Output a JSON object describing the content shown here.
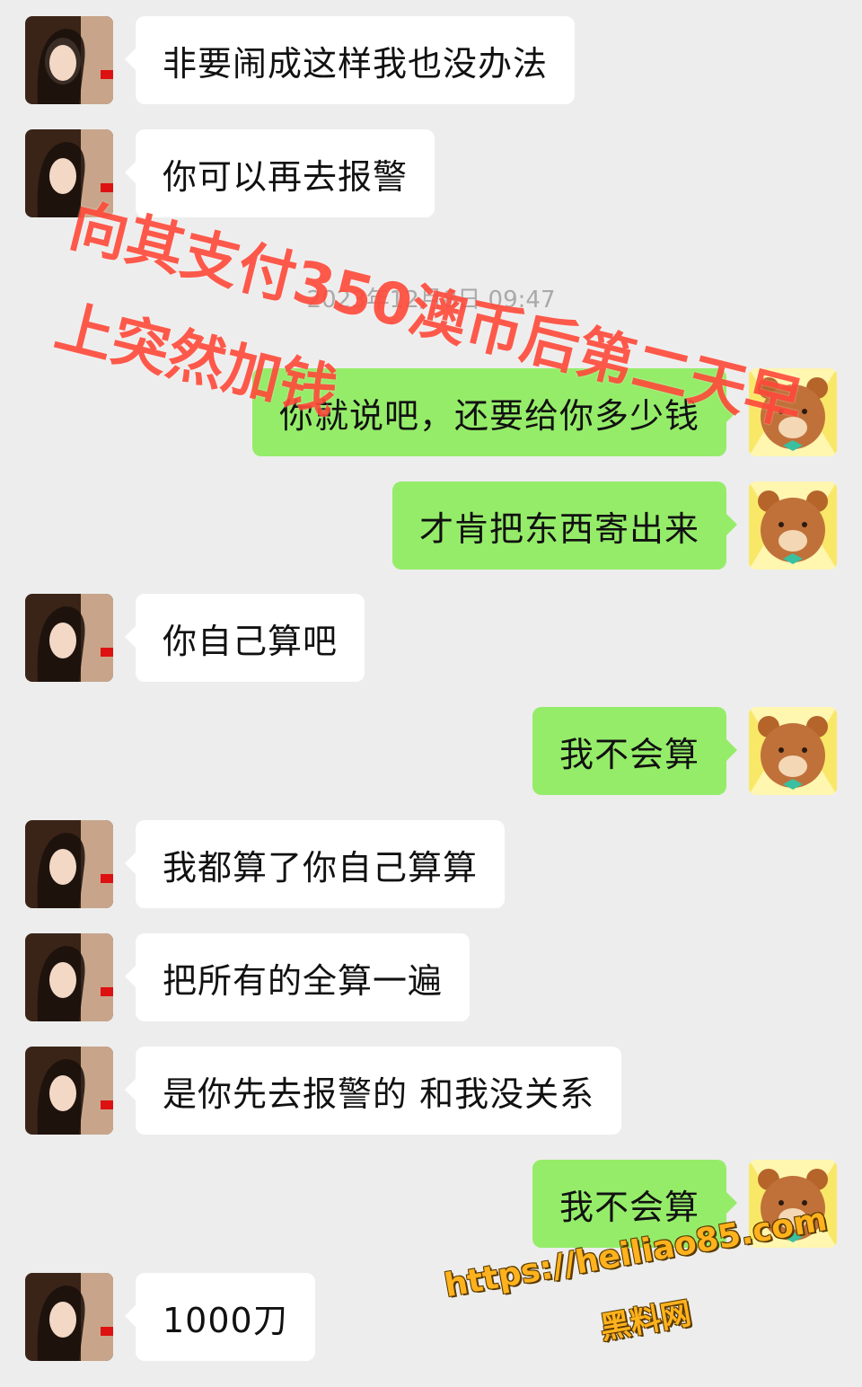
{
  "messages": [
    {
      "side": "left",
      "text": "非要闹成这样我也没办法"
    },
    {
      "side": "left",
      "text": "你可以再去报警"
    },
    {
      "side": "right",
      "text": "你就说吧，还要给你多少钱"
    },
    {
      "side": "right",
      "text": "才肯把东西寄出来"
    },
    {
      "side": "left",
      "text": "你自己算吧"
    },
    {
      "side": "right",
      "text": "我不会算"
    },
    {
      "side": "left",
      "text": "我都算了你自己算算"
    },
    {
      "side": "left",
      "text": "把所有的全算一遍"
    },
    {
      "side": "left",
      "text": "是你先去报警的 和我没关系"
    },
    {
      "side": "right",
      "text": "我不会算"
    },
    {
      "side": "left",
      "text": "1000刀"
    }
  ],
  "timestamp": "2023年12月8日 09:47",
  "overlay": {
    "line1": "向其支付350澳币后第二天早",
    "line2": "上突然加钱"
  },
  "watermark": {
    "url": "https://heiliao85.com",
    "name": "黑料网"
  },
  "colors": {
    "background": "#ededed",
    "sent_bubble": "#95ec69",
    "received_bubble": "#ffffff",
    "overlay_text": "#ff4a3a",
    "watermark_text": "#ffb21d"
  },
  "icons": {
    "left_avatar": "woman-portrait-avatar",
    "right_avatar": "bear-sticker-avatar"
  }
}
